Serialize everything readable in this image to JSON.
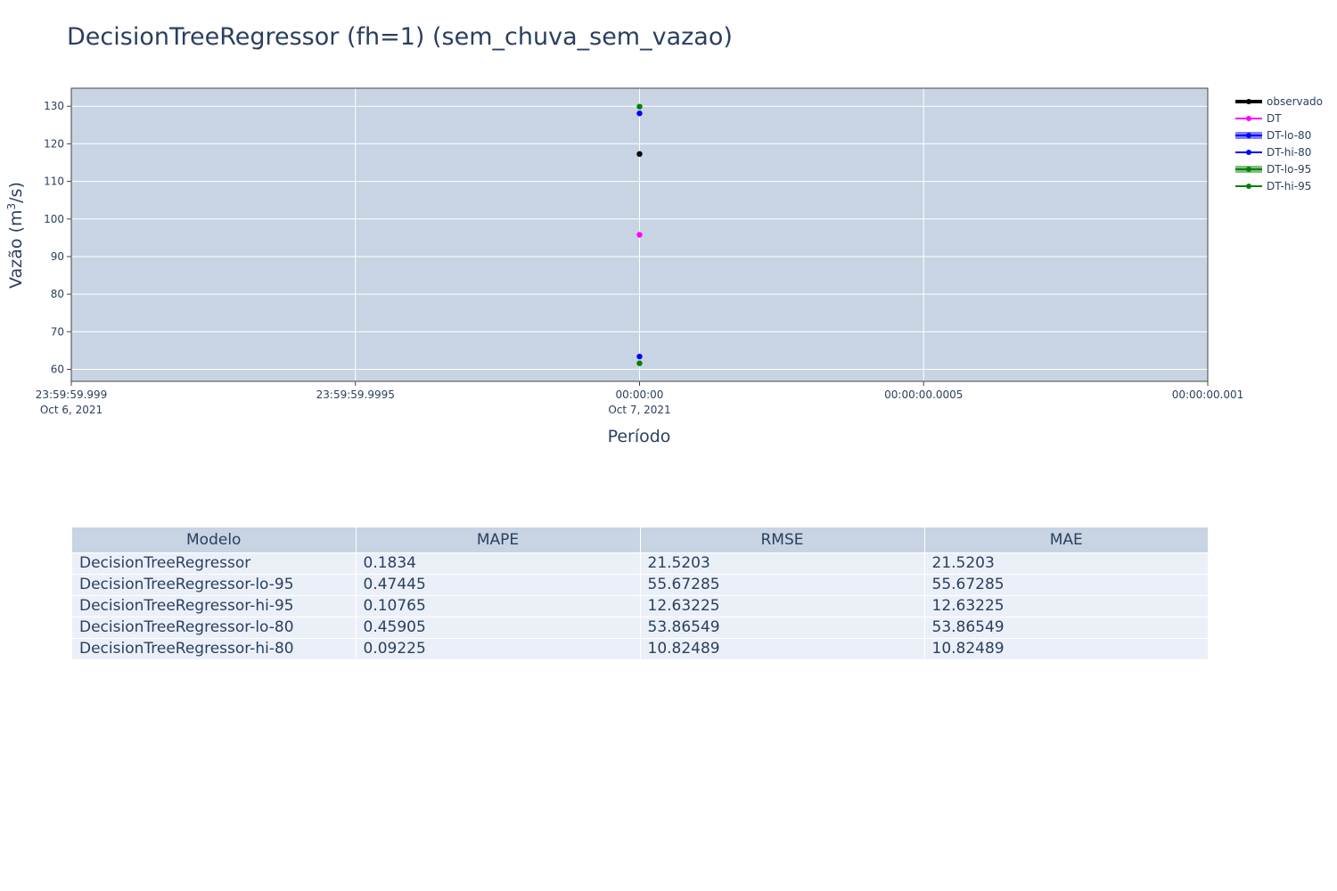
{
  "chart_data": {
    "type": "scatter",
    "title": "DecisionTreeRegressor (fh=1) (sem_chuva_sem_vazao)",
    "xlabel": "Período",
    "ylabel_prefix": "Vazão (m",
    "ylabel_sup": "3",
    "ylabel_suffix": "/s)",
    "x_ticks": [
      {
        "line1": "23:59:59.999",
        "line2": "Oct 6, 2021"
      },
      {
        "line1": "23:59:59.9995",
        "line2": ""
      },
      {
        "line1": "00:00:00",
        "line2": "Oct 7, 2021"
      },
      {
        "line1": "00:00:00.0005",
        "line2": ""
      },
      {
        "line1": "00:00:00.001",
        "line2": ""
      }
    ],
    "x_tick_values_ms": [
      -1,
      -0.5,
      0,
      0.5,
      1
    ],
    "xlim_ms": [
      -1,
      1
    ],
    "y_ticks": [
      60,
      70,
      80,
      90,
      100,
      110,
      120,
      130
    ],
    "ylim": [
      56.8,
      134.8
    ],
    "grid": true,
    "legend_position": "top-right",
    "series": [
      {
        "name": "observado",
        "color": "#000000",
        "x_ms": 0,
        "y": 117.3,
        "legend_style": "thick"
      },
      {
        "name": "DT",
        "color": "#ff00ff",
        "x_ms": 0,
        "y": 95.8,
        "legend_style": "line"
      },
      {
        "name": "DT-lo-80",
        "color": "#0000ff",
        "x_ms": 0,
        "y": 63.4,
        "legend_style": "band"
      },
      {
        "name": "DT-hi-80",
        "color": "#0000ff",
        "x_ms": 0,
        "y": 128.1,
        "legend_style": "line"
      },
      {
        "name": "DT-lo-95",
        "color": "#008000",
        "x_ms": 0,
        "y": 61.6,
        "legend_style": "band"
      },
      {
        "name": "DT-hi-95",
        "color": "#008000",
        "x_ms": 0,
        "y": 129.9,
        "legend_style": "line"
      }
    ],
    "plot_background": "#c8d4e3"
  },
  "table": {
    "headers": [
      "Modelo",
      "MAPE",
      "RMSE",
      "MAE"
    ],
    "rows": [
      [
        "DecisionTreeRegressor",
        "0.1834",
        "21.5203",
        "21.5203"
      ],
      [
        "DecisionTreeRegressor-lo-95",
        "0.47445",
        "55.67285",
        "55.67285"
      ],
      [
        "DecisionTreeRegressor-hi-95",
        "0.10765",
        "12.63225",
        "12.63225"
      ],
      [
        "DecisionTreeRegressor-lo-80",
        "0.45905",
        "53.86549",
        "53.86549"
      ],
      [
        "DecisionTreeRegressor-hi-80",
        "0.09225",
        "10.82489",
        "10.82489"
      ]
    ],
    "header_color": "#c8d4e3",
    "cell_color": "#ebf0f8"
  }
}
